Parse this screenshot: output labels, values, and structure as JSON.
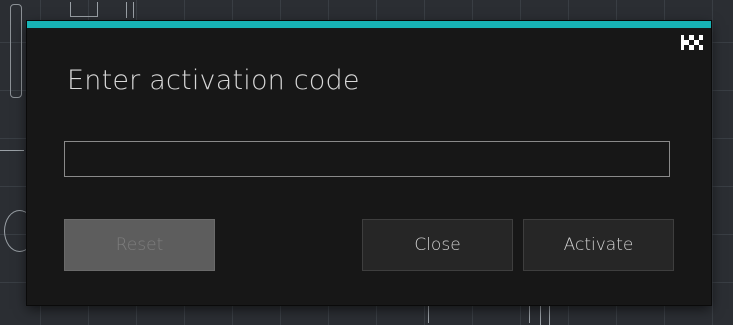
{
  "dialog": {
    "title": "Enter activation code",
    "accent_color": "#17b3b5",
    "logo_icon": "checkered-logo-icon",
    "code_input": {
      "value": "",
      "placeholder": ""
    },
    "buttons": {
      "reset_label": "Reset",
      "close_label": "Close",
      "activate_label": "Activate"
    },
    "reset_disabled": true
  }
}
